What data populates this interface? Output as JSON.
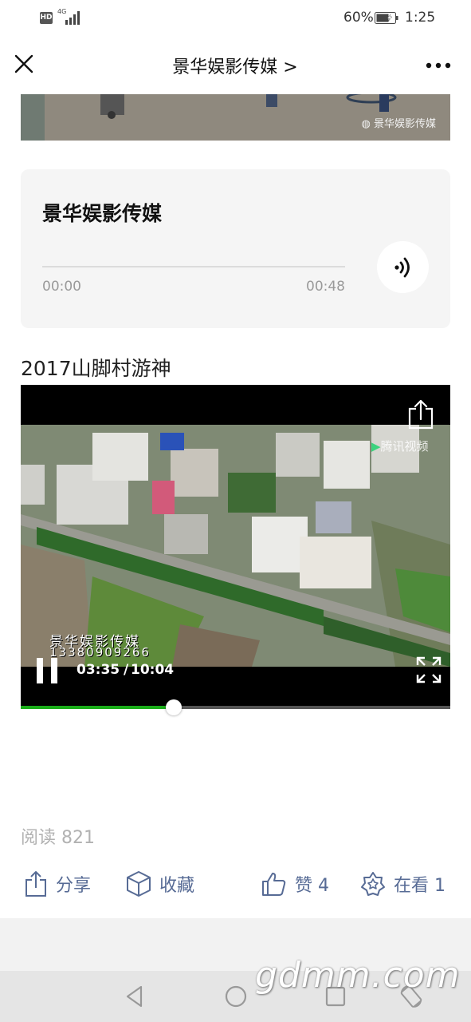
{
  "status_bar": {
    "hd_badge": "HD",
    "network": "4G",
    "battery_percent": "60%",
    "time": "1:25"
  },
  "nav": {
    "title": "景华娱影传媒 >"
  },
  "top_image": {
    "watermark": "景华娱影传媒"
  },
  "audio": {
    "title": "景华娱影传媒",
    "time_start": "00:00",
    "time_end": "00:48",
    "progress": 0
  },
  "video": {
    "title": "2017山脚村游神",
    "overlay_logo": "腾讯视频",
    "watermark_name": "景华娱影传媒",
    "watermark_phone": "13380909266",
    "current_time": "03:35",
    "separator": "/",
    "total_time": "10:04",
    "progress": 0.356
  },
  "stats": {
    "read_count": "阅读 821"
  },
  "actions": {
    "share": "分享",
    "collect": "收藏",
    "like": "赞 4",
    "watching": "在看 1"
  },
  "colors": {
    "link": "#576b95",
    "progress_fill": "#1aad19",
    "card_bg": "#f5f5f5"
  },
  "site_watermark": "gdmm.com"
}
